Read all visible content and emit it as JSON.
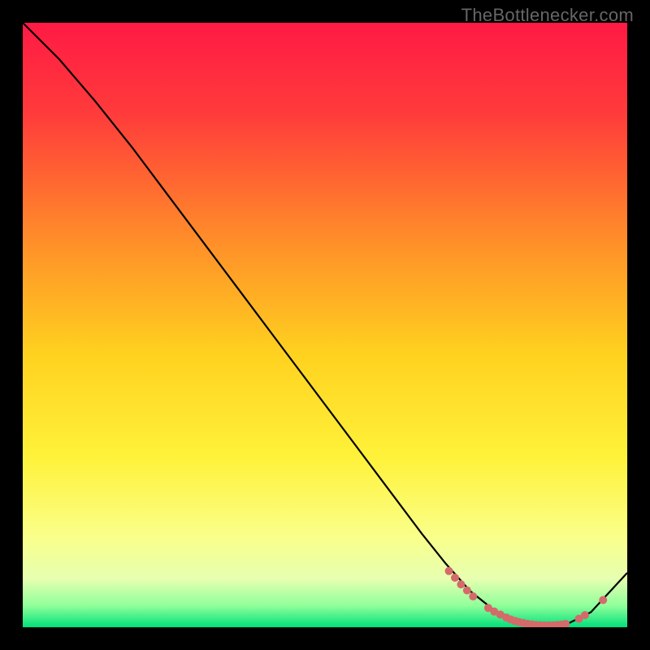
{
  "watermark": "TheBottlenecker.com",
  "chart_data": {
    "type": "line",
    "title": "",
    "xlabel": "",
    "ylabel": "",
    "xlim": [
      0,
      100
    ],
    "ylim": [
      0,
      100
    ],
    "background_gradient": {
      "stops": [
        {
          "offset": 0.0,
          "color": "#ff1a44"
        },
        {
          "offset": 0.15,
          "color": "#ff3b3b"
        },
        {
          "offset": 0.35,
          "color": "#ff8a2a"
        },
        {
          "offset": 0.55,
          "color": "#ffd21f"
        },
        {
          "offset": 0.72,
          "color": "#fff23a"
        },
        {
          "offset": 0.85,
          "color": "#faff8a"
        },
        {
          "offset": 0.92,
          "color": "#e6ffb0"
        },
        {
          "offset": 0.965,
          "color": "#8eff9a"
        },
        {
          "offset": 1.0,
          "color": "#00e07a"
        }
      ]
    },
    "series": [
      {
        "name": "bottleneck-curve",
        "x": [
          0,
          6,
          12,
          18,
          24,
          30,
          36,
          42,
          48,
          54,
          60,
          66,
          70,
          74,
          78,
          82,
          86,
          90,
          94,
          100
        ],
        "y": [
          100,
          94,
          87,
          79.5,
          71.5,
          63.5,
          55.5,
          47.5,
          39.5,
          31.5,
          23.5,
          15.5,
          10.5,
          6,
          2.8,
          1,
          0.3,
          0.5,
          2.5,
          9
        ]
      }
    ],
    "markers": {
      "name": "highlight-dots",
      "color": "#d46a6a",
      "points": [
        {
          "x": 70.5,
          "y": 9.3
        },
        {
          "x": 71.5,
          "y": 8.2
        },
        {
          "x": 72.5,
          "y": 7.1
        },
        {
          "x": 73.5,
          "y": 6.1
        },
        {
          "x": 74.5,
          "y": 5.1
        },
        {
          "x": 77,
          "y": 3.2
        },
        {
          "x": 78,
          "y": 2.6
        },
        {
          "x": 79,
          "y": 2.1
        },
        {
          "x": 80,
          "y": 1.6
        },
        {
          "x": 80.7,
          "y": 1.3
        },
        {
          "x": 81.4,
          "y": 1.05
        },
        {
          "x": 82.1,
          "y": 0.85
        },
        {
          "x": 82.8,
          "y": 0.7
        },
        {
          "x": 83.5,
          "y": 0.55
        },
        {
          "x": 84.2,
          "y": 0.45
        },
        {
          "x": 84.9,
          "y": 0.38
        },
        {
          "x": 85.6,
          "y": 0.33
        },
        {
          "x": 86.3,
          "y": 0.3
        },
        {
          "x": 87,
          "y": 0.3
        },
        {
          "x": 87.7,
          "y": 0.32
        },
        {
          "x": 88.4,
          "y": 0.37
        },
        {
          "x": 89.1,
          "y": 0.44
        },
        {
          "x": 89.8,
          "y": 0.55
        },
        {
          "x": 92,
          "y": 1.4
        },
        {
          "x": 93,
          "y": 2.0
        },
        {
          "x": 96,
          "y": 4.5
        }
      ]
    }
  }
}
